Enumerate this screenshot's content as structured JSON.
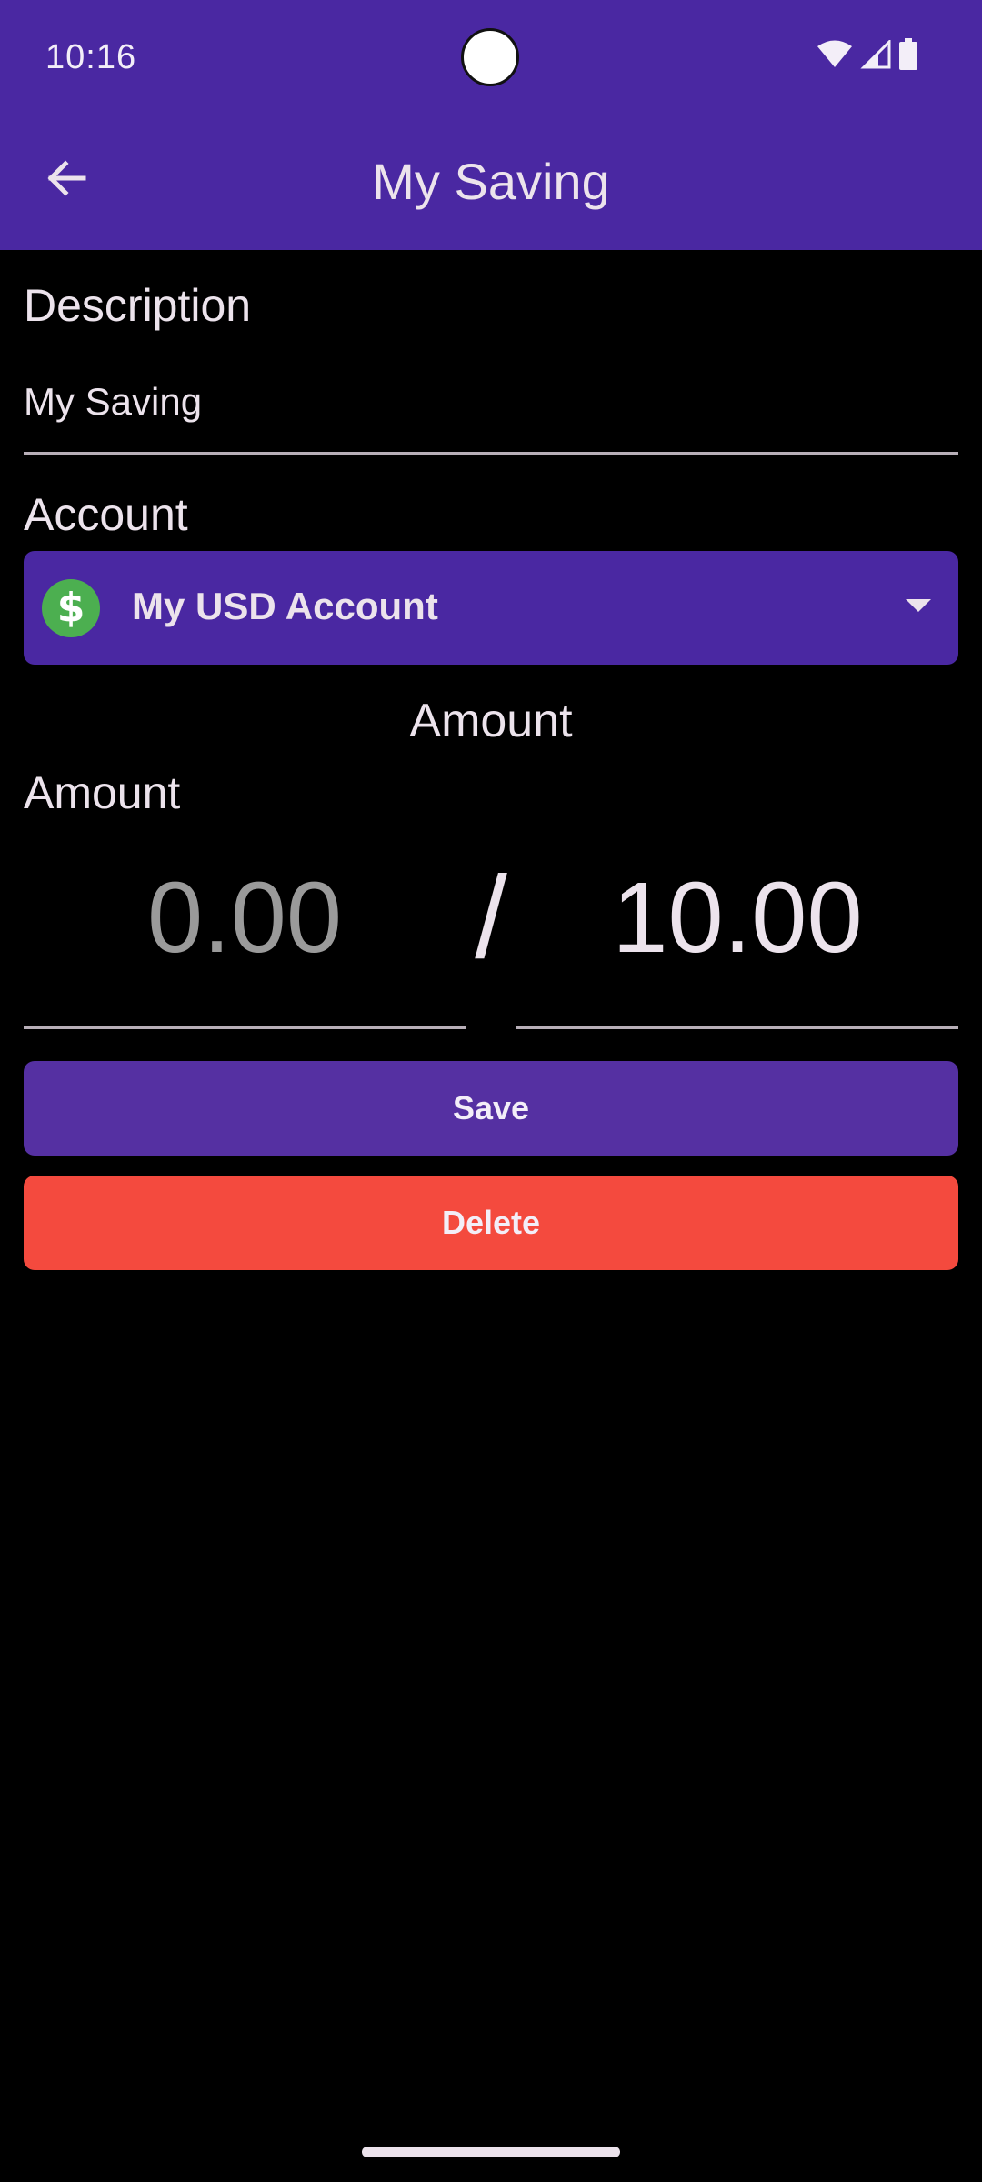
{
  "status_bar": {
    "time": "10:16",
    "icons": [
      "wifi-icon",
      "signal-icon",
      "battery-icon"
    ]
  },
  "app_bar": {
    "title": "My Saving",
    "back_icon": "arrow-left-icon",
    "background": "#4A28A2"
  },
  "form": {
    "description": {
      "label": "Description",
      "value": "My Saving"
    },
    "account": {
      "label": "Account",
      "selected": "My USD Account",
      "icon": "dollar-icon",
      "icon_color": "#4CAF50"
    },
    "amount": {
      "section_title": "Amount",
      "label": "Amount",
      "current": "0.00",
      "separator": "/",
      "target": "10.00"
    }
  },
  "actions": {
    "save_label": "Save",
    "save_color": "#5530A2",
    "delete_label": "Delete",
    "delete_color": "#F44A3E"
  }
}
